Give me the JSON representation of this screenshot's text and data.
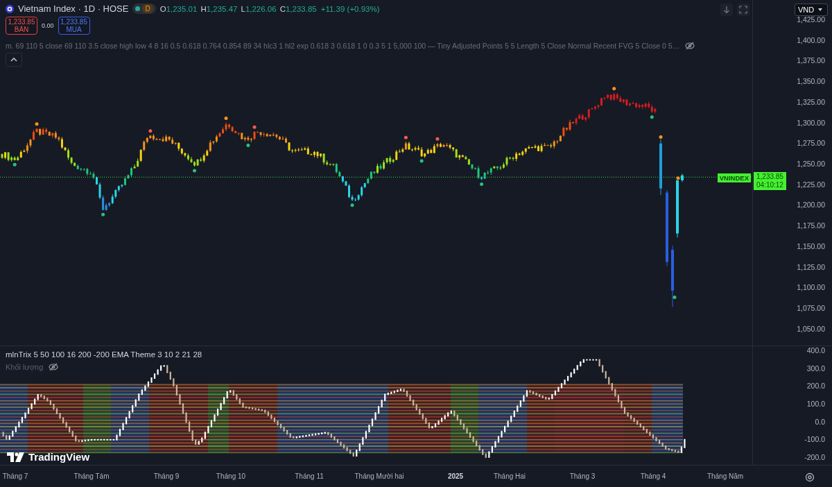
{
  "header": {
    "title": "Vietnam Index · 1D · HOSE",
    "session_badge": "D",
    "ohlc": [
      {
        "label": "O",
        "value": "1,235.01"
      },
      {
        "label": "H",
        "value": "1,235.47"
      },
      {
        "label": "L",
        "value": "1,226.06"
      },
      {
        "label": "C",
        "value": "1,233.85"
      }
    ],
    "change": "+11.39 (+0.93%)"
  },
  "trade": {
    "sell": {
      "price": "1,233.85",
      "label": "BÁN"
    },
    "spread": "0.00",
    "buy": {
      "price": "1,233.85",
      "label": "MUA"
    }
  },
  "indicator_legend": {
    "text": "m. 69 110 5 close 69 110 3.5 close high low 4 8 16 0.5 0.618 0.764 0.854 89 34 hlc3 1 hl2 exp 0.618 3 0.618 1 0 0.3 5 1 5,000 100 — Tiny Adjusted Points 5 5 Length 5 Close Normal Recent FVG 5 Close 0 5…"
  },
  "toolbar": {
    "currency": "VND"
  },
  "price_axis": {
    "labels": [
      "1,425.00",
      "1,400.00",
      "1,375.00",
      "1,350.00",
      "1,325.00",
      "1,300.00",
      "1,275.00",
      "1,250.00",
      "1,225.00",
      "1,200.00",
      "1,175.00",
      "1,150.00",
      "1,125.00",
      "1,100.00",
      "1,075.00",
      "1,050.00"
    ]
  },
  "price_tag": {
    "symbol": "VNINDEX",
    "price": "1,233.85",
    "countdown": "04:10:12"
  },
  "oscillator_pane": {
    "title": "mlnTrix 5 50 100 16 200 -200 EMA Theme 3 10 2 21 28",
    "hidden_indicator": "Khối lượng",
    "axis_labels": [
      "400.0",
      "300.0",
      "200.0",
      "100.0",
      "0.0",
      "-100.0",
      "-200.0"
    ]
  },
  "logo": {
    "text": "TradingView"
  },
  "time_axis": {
    "labels": [
      {
        "text": "Tháng 7",
        "kind": "month"
      },
      {
        "text": "Tháng Tám",
        "kind": "month"
      },
      {
        "text": "Tháng 9",
        "kind": "month"
      },
      {
        "text": "Tháng 10",
        "kind": "month"
      },
      {
        "text": "Tháng 11",
        "kind": "month"
      },
      {
        "text": "Tháng Mười hai",
        "kind": "month"
      },
      {
        "text": "2025",
        "kind": "year"
      },
      {
        "text": "Tháng Hai",
        "kind": "month"
      },
      {
        "text": "Tháng 3",
        "kind": "month"
      },
      {
        "text": "Tháng 4",
        "kind": "month"
      },
      {
        "text": "Tháng Năm",
        "kind": "month"
      }
    ]
  }
}
